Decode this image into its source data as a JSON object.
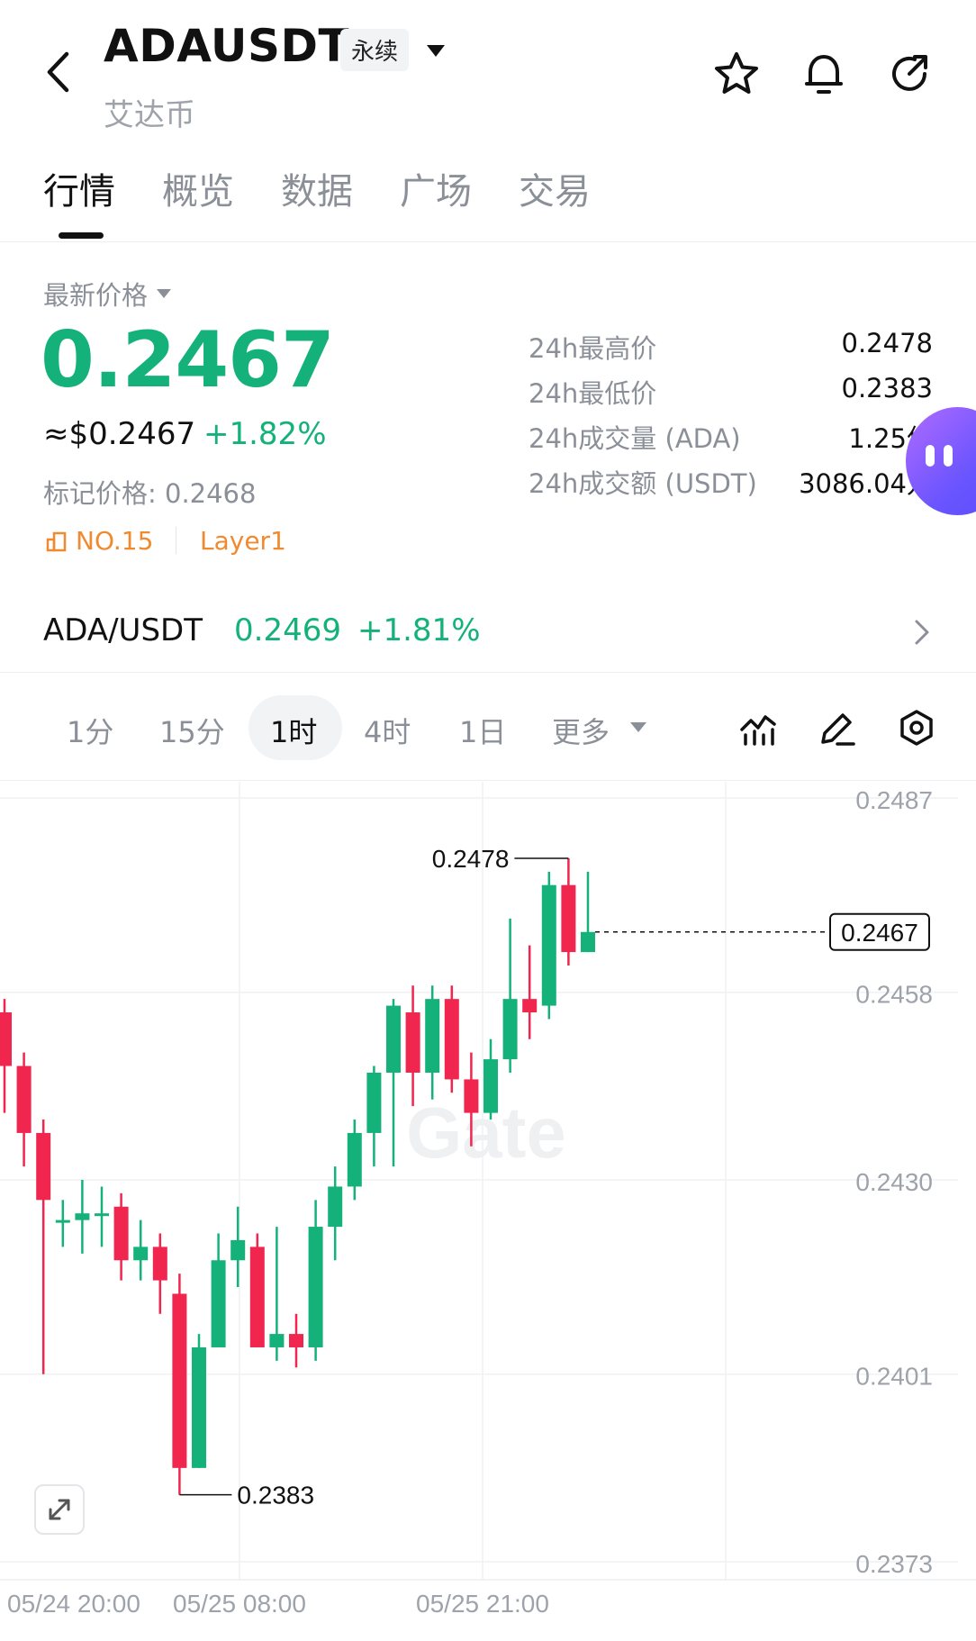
{
  "header": {
    "symbol": "ADAUSDT",
    "contract_type": "永续",
    "name": "艾达币",
    "icons": [
      "back-icon",
      "star-icon",
      "bell-icon",
      "refresh-icon"
    ]
  },
  "tabs": [
    {
      "label": "行情",
      "active": true
    },
    {
      "label": "概览",
      "active": false
    },
    {
      "label": "数据",
      "active": false
    },
    {
      "label": "广场",
      "active": false
    },
    {
      "label": "交易",
      "active": false
    }
  ],
  "price": {
    "latest_label": "最新价格",
    "last": "0.2467",
    "usd": "≈$0.2467",
    "change": "+1.82%",
    "mark": "标记价格: 0.2468",
    "rank": "NO.15",
    "tag": "Layer1",
    "up_color": "#14b27a",
    "down_color": "#f0264f",
    "accent_color": "#f08a31"
  },
  "stats": [
    {
      "label": "24h最高价",
      "value": "0.2478"
    },
    {
      "label": "24h最低价",
      "value": "0.2383"
    },
    {
      "label": "24h成交量 (ADA)",
      "value": "1.25亿"
    },
    {
      "label": "24h成交额 (USDT)",
      "value": "3086.04万"
    }
  ],
  "spot": {
    "pair": "ADA/USDT",
    "price": "0.2469",
    "change": "+1.81%"
  },
  "intervals": [
    {
      "label": "1分",
      "active": false
    },
    {
      "label": "15分",
      "active": false
    },
    {
      "label": "1时",
      "active": true
    },
    {
      "label": "4时",
      "active": false
    },
    {
      "label": "1日",
      "active": false
    },
    {
      "label": "更多",
      "active": false
    }
  ],
  "chart_tools": [
    "indicator-icon",
    "draw-icon",
    "settings-icon",
    "expand-icon"
  ],
  "watermark": "Gate",
  "chart_data": {
    "type": "candlestick",
    "interval": "1时",
    "y_ticks": [
      "0.2487",
      "0.2458",
      "0.2430",
      "0.2401",
      "0.2373"
    ],
    "x_ticks": [
      "05/24 20:00",
      "05/25 08:00",
      "05/25 21:00"
    ],
    "ylim": [
      0.2373,
      0.2487
    ],
    "high_label": "0.2478",
    "low_label": "0.2383",
    "last_price_label": "0.2467",
    "grid": true,
    "candles": [
      {
        "o": 0.2455,
        "h": 0.2457,
        "l": 0.244,
        "c": 0.2447
      },
      {
        "o": 0.2447,
        "h": 0.2449,
        "l": 0.2432,
        "c": 0.2437
      },
      {
        "o": 0.2437,
        "h": 0.2439,
        "l": 0.2401,
        "c": 0.2427
      },
      {
        "o": 0.2424,
        "h": 0.2427,
        "l": 0.242,
        "c": 0.2424
      },
      {
        "o": 0.2424,
        "h": 0.243,
        "l": 0.2419,
        "c": 0.2425
      },
      {
        "o": 0.2425,
        "h": 0.2429,
        "l": 0.242,
        "c": 0.2425
      },
      {
        "o": 0.2426,
        "h": 0.2428,
        "l": 0.2415,
        "c": 0.2418
      },
      {
        "o": 0.2418,
        "h": 0.2424,
        "l": 0.2415,
        "c": 0.242
      },
      {
        "o": 0.242,
        "h": 0.2422,
        "l": 0.241,
        "c": 0.2415
      },
      {
        "o": 0.2413,
        "h": 0.2416,
        "l": 0.2383,
        "c": 0.2387
      },
      {
        "o": 0.2387,
        "h": 0.2407,
        "l": 0.2387,
        "c": 0.2405
      },
      {
        "o": 0.2405,
        "h": 0.2422,
        "l": 0.2405,
        "c": 0.2418
      },
      {
        "o": 0.2418,
        "h": 0.2426,
        "l": 0.2414,
        "c": 0.2421
      },
      {
        "o": 0.242,
        "h": 0.2422,
        "l": 0.2405,
        "c": 0.2405
      },
      {
        "o": 0.2405,
        "h": 0.2423,
        "l": 0.2403,
        "c": 0.2407
      },
      {
        "o": 0.2407,
        "h": 0.241,
        "l": 0.2402,
        "c": 0.2405
      },
      {
        "o": 0.2405,
        "h": 0.2427,
        "l": 0.2403,
        "c": 0.2423
      },
      {
        "o": 0.2423,
        "h": 0.2432,
        "l": 0.2418,
        "c": 0.2429
      },
      {
        "o": 0.2429,
        "h": 0.2439,
        "l": 0.2427,
        "c": 0.2437
      },
      {
        "o": 0.2437,
        "h": 0.2447,
        "l": 0.2432,
        "c": 0.2446
      },
      {
        "o": 0.2446,
        "h": 0.2457,
        "l": 0.2432,
        "c": 0.2456
      },
      {
        "o": 0.2455,
        "h": 0.2459,
        "l": 0.2441,
        "c": 0.2446
      },
      {
        "o": 0.2446,
        "h": 0.2459,
        "l": 0.2442,
        "c": 0.2457
      },
      {
        "o": 0.2457,
        "h": 0.2459,
        "l": 0.2443,
        "c": 0.2445
      },
      {
        "o": 0.2445,
        "h": 0.2449,
        "l": 0.2435,
        "c": 0.244
      },
      {
        "o": 0.244,
        "h": 0.2451,
        "l": 0.2439,
        "c": 0.2448
      },
      {
        "o": 0.2448,
        "h": 0.2469,
        "l": 0.2446,
        "c": 0.2457
      },
      {
        "o": 0.2457,
        "h": 0.2465,
        "l": 0.2451,
        "c": 0.2455
      },
      {
        "o": 0.2456,
        "h": 0.2476,
        "l": 0.2454,
        "c": 0.2474
      },
      {
        "o": 0.2474,
        "h": 0.2478,
        "l": 0.2462,
        "c": 0.2464
      },
      {
        "o": 0.2464,
        "h": 0.2476,
        "l": 0.2464,
        "c": 0.2467
      }
    ]
  }
}
